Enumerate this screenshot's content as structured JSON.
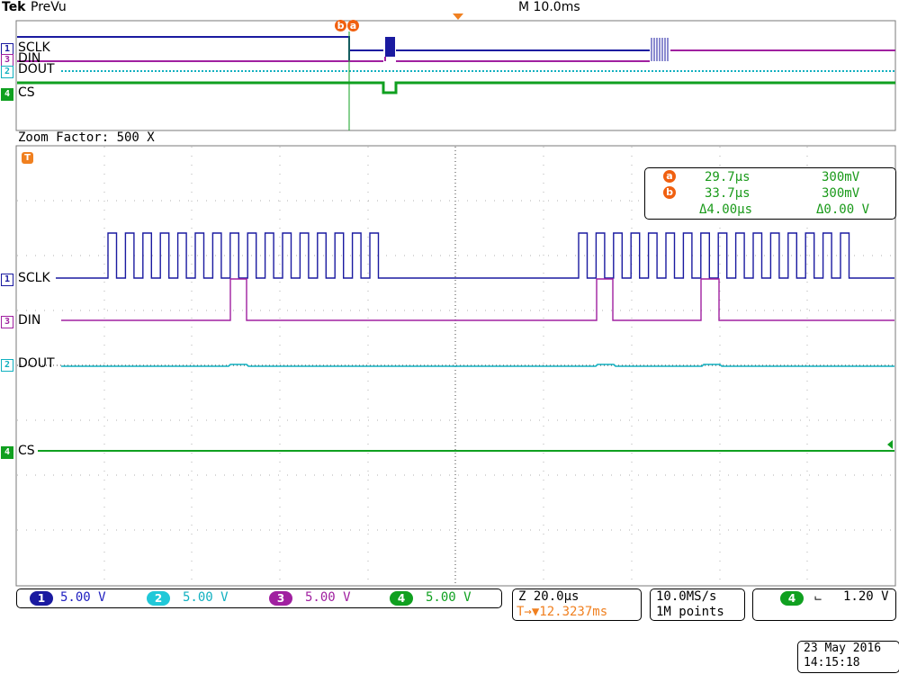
{
  "header": {
    "brand": "Tek",
    "mode": "PreVu",
    "timebase": "M 10.0ms"
  },
  "overview": {
    "cursor_markers": [
      "b",
      "a"
    ],
    "channels": [
      {
        "marker": "1",
        "label": "SCLK",
        "color": "#1a1aa0"
      },
      {
        "marker": "3",
        "label": "DIN",
        "color": "#a020a0"
      },
      {
        "marker": "2",
        "label": "DOUT",
        "color": "#10b0c0"
      },
      {
        "marker": "4",
        "label": "CS",
        "color": "#10a020"
      }
    ]
  },
  "zoom": {
    "label": "Zoom Factor: 500 X",
    "trigger_marker": "T",
    "channels": [
      {
        "marker": "1",
        "label": "SCLK",
        "color": "#1a1aa0"
      },
      {
        "marker": "3",
        "label": "DIN",
        "color": "#a020a0"
      },
      {
        "marker": "2",
        "label": "DOUT",
        "color": "#10b0c0"
      },
      {
        "marker": "4",
        "label": "CS",
        "color": "#10a020"
      }
    ]
  },
  "cursors": {
    "a": {
      "badge": "a",
      "time": "29.7µs",
      "volt": "300mV"
    },
    "b": {
      "badge": "b",
      "time": "33.7µs",
      "volt": "300mV"
    },
    "delta": {
      "time": "Δ4.00µs",
      "volt": "Δ0.00 V"
    }
  },
  "status": {
    "channels": [
      {
        "num": "1",
        "value": "5.00 V",
        "color": "#1a1aa0",
        "text_color": "#2020c0"
      },
      {
        "num": "2",
        "value": "5.00 V",
        "color": "#20c8d8",
        "text_color": "#10b0c0"
      },
      {
        "num": "3",
        "value": "5.00 V",
        "color": "#a020a0",
        "text_color": "#a020a0"
      },
      {
        "num": "4",
        "value": "5.00 V",
        "color": "#10a020",
        "text_color": "#10a020"
      }
    ],
    "zoom_timebase": "Z 20.0µs",
    "trigger_position": "T→▼12.3237ms",
    "sample_rate": "10.0MS/s",
    "record_length": "1M points",
    "trigger_channel": "4",
    "trigger_slope": "⨽",
    "trigger_level": "1.20 V",
    "date": "23 May 2016",
    "time": "14:15:18"
  }
}
